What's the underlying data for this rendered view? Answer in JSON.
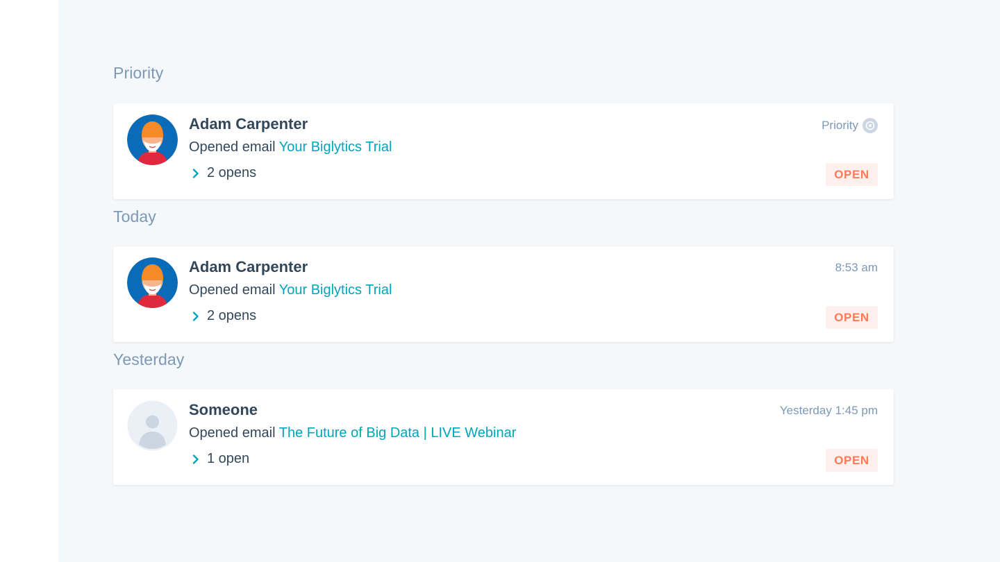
{
  "sections": [
    {
      "title": "Priority",
      "card": {
        "name": "Adam Carpenter",
        "activity_prefix": "Opened email",
        "email_subject": "Your Biglytics Trial",
        "opens_label": "2 opens",
        "timestamp": "Priority",
        "status": "OPEN",
        "avatar_icon": "person-avatar-icon"
      }
    },
    {
      "title": "Today",
      "card": {
        "name": "Adam Carpenter",
        "activity_prefix": "Opened email",
        "email_subject": "Your Biglytics Trial",
        "opens_label": "2 opens",
        "timestamp": "8:53 am",
        "status": "OPEN",
        "avatar_icon": "person-avatar-icon"
      }
    },
    {
      "title": "Yesterday",
      "card": {
        "name": "Someone",
        "activity_prefix": "Opened email",
        "email_subject": "The Future of Big Data | LIVE Webinar",
        "opens_label": "1 open",
        "timestamp": "Yesterday 1:45 pm",
        "status": "OPEN",
        "avatar_icon": "default-user-icon"
      }
    }
  ],
  "colors": {
    "background": "#f5f8fa",
    "section_title": "#7c98b6",
    "text": "#33475b",
    "link": "#00a4bd",
    "status_text": "#ff7a59",
    "status_bg": "#fef0ec"
  }
}
